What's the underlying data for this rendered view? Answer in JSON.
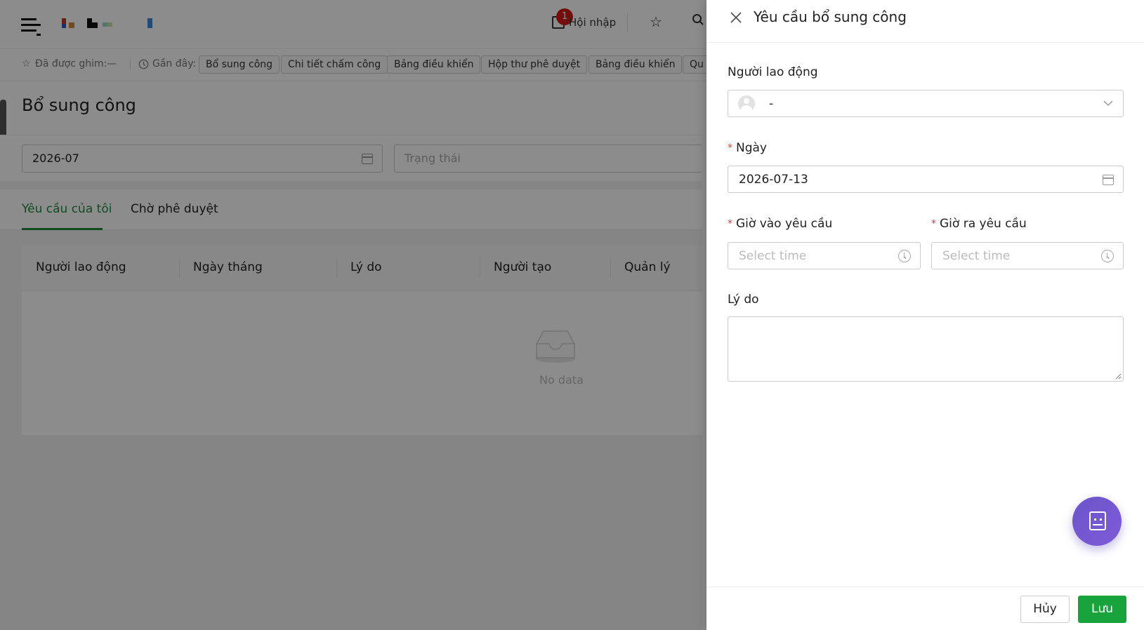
{
  "header": {
    "notification_count": "1",
    "notification_label": "Hội nhập"
  },
  "pinbar": {
    "pinned_label": "Đã được ghim:",
    "pinned_value": "—",
    "recent_label": "Gần đây:",
    "recent_items": [
      "Bổ sung công",
      "Chi tiết chấm công",
      "Bảng điều khiển",
      "Hộp thư phê duyệt",
      "Bảng điều khiển",
      "Qu"
    ]
  },
  "page": {
    "title": "Bổ sung công",
    "month_filter_value": "2026-07",
    "status_placeholder": "Trạng thái",
    "tabs": [
      "Yêu cầu của tôi",
      "Chờ phê duyệt"
    ],
    "table_headers": [
      "Người lao động",
      "Ngày tháng",
      "Lý do",
      "Người tạo",
      "Quản lý"
    ],
    "empty_text": "No data"
  },
  "drawer": {
    "title": "Yêu cầu bổ sung công",
    "employee_label": "Người lao động",
    "employee_value": "-",
    "date_label": "Ngày",
    "date_value": "2026-07-13",
    "time_in_label": "Giờ vào yêu cầu",
    "time_out_label": "Giờ ra yêu cầu",
    "time_placeholder": "Select time",
    "reason_label": "Lý do",
    "cancel_label": "Hủy",
    "save_label": "Lưu"
  },
  "colors": {
    "accent_green": "#1f8a3c",
    "save_button": "#19a33d",
    "required_star": "#e53935",
    "fab_purple": "#6b55c9"
  }
}
